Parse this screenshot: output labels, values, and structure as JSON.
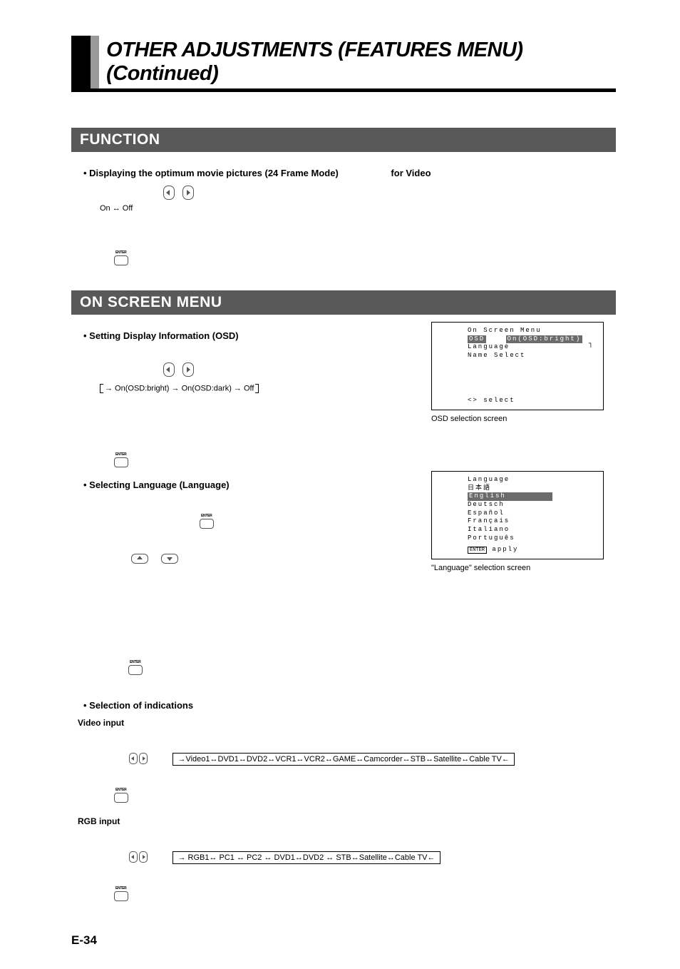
{
  "title": "OTHER ADJUSTMENTS (FEATURES MENU) (Continued)",
  "sections": {
    "function": {
      "heading": "FUNCTION",
      "bullet": "• Displaying the optimum movie pictures (24 Frame Mode)",
      "for_video": "for Video",
      "on_off": "On ↔ Off"
    },
    "osm": {
      "heading": "ON SCREEN MENU",
      "bullet_osd": "• Setting Display Information (OSD)",
      "osd_cycle": "→ On(OSD:bright) → On(OSD:dark) → Off",
      "osd_screen": {
        "title": "On Screen Menu",
        "row1_left": "OSD",
        "row1_right": "On(OSD:bright)",
        "row2": "Language",
        "row3": "Name Select",
        "bottom": "<> select"
      },
      "osd_caption": "OSD selection screen",
      "bullet_lang": "• Selecting Language (Language)",
      "lang_screen": {
        "title": "Language",
        "jp": "日本語",
        "en": "English",
        "de": "Deutsch",
        "es": "Español",
        "fr": "Français",
        "it": "Italiano",
        "pt": "Português",
        "bottom": "apply"
      },
      "lang_caption": "\"Language\" selection screen",
      "bullet_ind": "• Selection of indications",
      "video_input_head": "Video input",
      "video_cycle": "→Video1↔DVD1↔DVD2↔VCR1↔VCR2↔GAME↔Camcorder↔STB↔Satellite↔Cable TV←",
      "rgb_input_head": "RGB input",
      "rgb_cycle": "→ RGB1↔ PC1 ↔ PC2 ↔ DVD1↔DVD2 ↔ STB↔Satellite↔Cable TV←"
    }
  },
  "enter_label": "ENTER",
  "page_number": "E-34"
}
